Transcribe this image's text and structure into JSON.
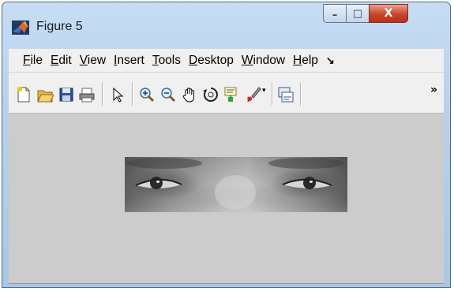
{
  "window": {
    "title": "Figure 5",
    "controls": {
      "minimize_glyph": "–",
      "maximize_glyph": "□",
      "close_glyph": "X"
    }
  },
  "menubar": {
    "items": [
      {
        "underline": "F",
        "rest": "ile"
      },
      {
        "underline": "E",
        "rest": "dit"
      },
      {
        "underline": "V",
        "rest": "iew"
      },
      {
        "underline": "I",
        "rest": "nsert"
      },
      {
        "underline": "T",
        "rest": "ools"
      },
      {
        "underline": "D",
        "rest": "esktop"
      },
      {
        "underline": "W",
        "rest": "indow"
      },
      {
        "underline": "H",
        "rest": "elp"
      }
    ],
    "overflow_glyph": "↘"
  },
  "toolbar": {
    "icons": [
      "new-figure-icon",
      "open-file-icon",
      "save-icon",
      "print-icon",
      "pointer-icon",
      "zoom-in-icon",
      "zoom-out-icon",
      "pan-hand-icon",
      "rotate-3d-icon",
      "data-cursor-icon",
      "brush-icon",
      "link-plot-icon"
    ],
    "dropdown_glyph": "▾",
    "more_glyph": "»"
  },
  "figure": {
    "background": "#cccccc",
    "image": "grayscale-eye-region"
  },
  "colors": {
    "titlebar": "#b7d1ec",
    "close_button": "#c6452c",
    "toolbar_bg": "#f0f0f0"
  }
}
